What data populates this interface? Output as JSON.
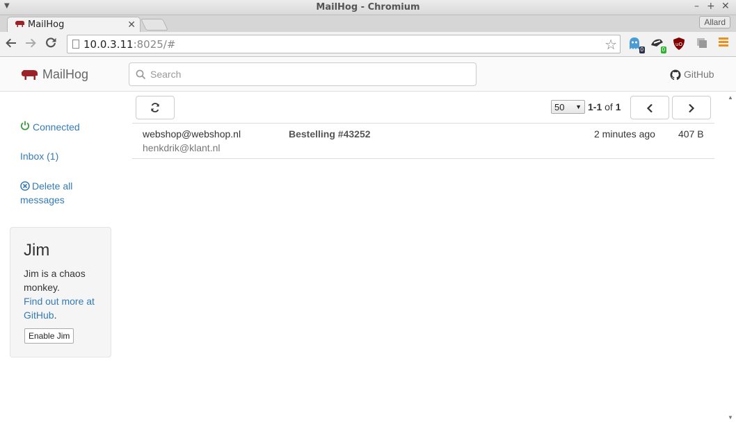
{
  "window": {
    "title": "MailHog - Chromium",
    "profile": "Allard"
  },
  "tab": {
    "label": "MailHog"
  },
  "address": {
    "host": "10.0.3.11",
    "rest": ":8025/#"
  },
  "extensions": {
    "ghostery_count": "0",
    "badger_count": "0"
  },
  "header": {
    "brand": "MailHog",
    "search_placeholder": "Search",
    "github_label": "GitHub"
  },
  "sidebar": {
    "connected": "Connected",
    "inbox": "Inbox (1)",
    "delete_all": "Delete all messages"
  },
  "jim": {
    "title": "Jim",
    "description": "Jim is a chaos monkey.",
    "link": "Find out more at GitHub",
    "link_suffix": ".",
    "button": "Enable Jim"
  },
  "pagination": {
    "page_size": "50",
    "range": "1-1",
    "of_label": "of",
    "total": "1"
  },
  "messages": [
    {
      "from": "webshop@webshop.nl",
      "to": "henkdrik@klant.nl",
      "subject": "Bestelling #43252",
      "time": "2 minutes ago",
      "size": "407 B"
    }
  ],
  "colors": {
    "link": "#337ab7",
    "brand": "#9b2226",
    "chrome_menu": "#e8911d"
  }
}
